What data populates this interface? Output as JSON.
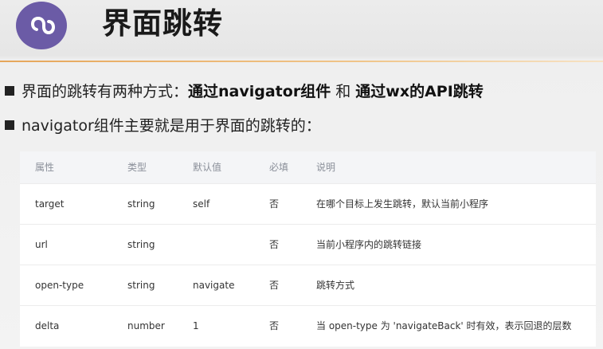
{
  "slide": {
    "title": "界面跳转",
    "logo_icon": "miniprogram-logo-icon",
    "accent_color": "#e6a65a",
    "logo_color": "#6b5ba6"
  },
  "bullets": {
    "line1": {
      "prefix": "界面的跳转有两种方式：",
      "emph1": "通过navigator组件",
      "mid": " 和 ",
      "emph2": "通过wx的API跳转"
    },
    "line2": {
      "text": "navigator组件主要就是用于界面的跳转的："
    }
  },
  "table": {
    "headers": {
      "name": "属性",
      "type": "类型",
      "default": "默认值",
      "required": "必填",
      "desc": "说明"
    },
    "rows": [
      {
        "name": "target",
        "type": "string",
        "default": "self",
        "required": "否",
        "desc": "在哪个目标上发生跳转，默认当前小程序"
      },
      {
        "name": "url",
        "type": "string",
        "default": "",
        "required": "否",
        "desc": "当前小程序内的跳转链接"
      },
      {
        "name": "open-type",
        "type": "string",
        "default": "navigate",
        "required": "否",
        "desc": "跳转方式"
      },
      {
        "name": "delta",
        "type": "number",
        "default": "1",
        "required": "否",
        "desc": "当 open-type 为 'navigateBack' 时有效，表示回退的层数"
      }
    ]
  }
}
